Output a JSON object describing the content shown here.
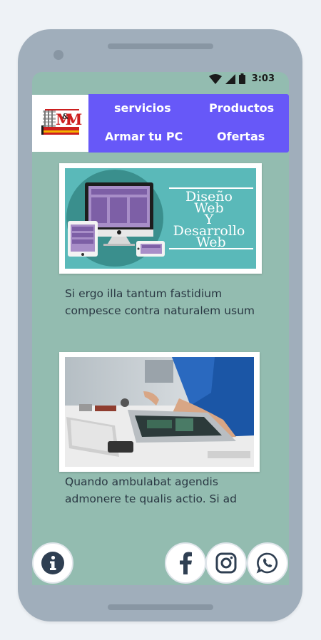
{
  "status": {
    "time": "3:03"
  },
  "logo": {
    "text_main": "M&M",
    "text_sub": "INFORMATICA",
    "text_tag": "COMPUTACION Y SERVICIOS"
  },
  "menu": {
    "items": [
      {
        "label": "servicios"
      },
      {
        "label": "Productos"
      },
      {
        "label": "Armar tu PC"
      },
      {
        "label": "Ofertas"
      }
    ]
  },
  "cards": [
    {
      "image_text": [
        "Diseño",
        "Web",
        "Y",
        "Desarrollo",
        "Web"
      ],
      "description": "Si ergo illa tantum fastidium compesce contra naturalem usum"
    },
    {
      "description": "Quando ambulabat agendis admonere te qualis actio. Si ad"
    }
  ],
  "footer": {
    "info_icon": "info-icon",
    "social": [
      "facebook-icon",
      "instagram-icon",
      "whatsapp-icon"
    ]
  },
  "colors": {
    "screen_bg": "#93bcb0",
    "menu_bg": "#6758f8",
    "phone_frame": "#a0aebb"
  }
}
